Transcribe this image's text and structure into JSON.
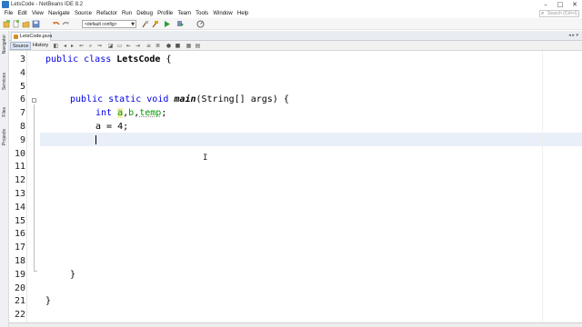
{
  "window": {
    "title": "LetsCode - NetBeans IDE 8.2",
    "controls": {
      "minimize": "–",
      "maximize": "□",
      "close": "✕"
    }
  },
  "menu": {
    "items": [
      "File",
      "Edit",
      "View",
      "Navigate",
      "Source",
      "Refactor",
      "Run",
      "Debug",
      "Profile",
      "Team",
      "Tools",
      "Window",
      "Help"
    ],
    "search_placeholder": "Search (Ctrl+I)",
    "search_icon": "search-icon"
  },
  "toolbar": {
    "config_value": "<default config>",
    "icons": [
      "new-project-icon",
      "new-file-icon",
      "open-project-icon",
      "save-all-icon",
      "undo-icon",
      "redo-icon",
      "clean-build-icon",
      "build-icon",
      "run-icon",
      "debug-icon",
      "profile-icon"
    ]
  },
  "side_tabs": [
    "Navigator",
    "Services",
    "Files",
    "Projects"
  ],
  "editor_tab": {
    "label": "LetsCode.java",
    "icon": "java-file-icon"
  },
  "editor_toolbar": {
    "source_label": "Source",
    "history_label": "History"
  },
  "colors": {
    "keyword": "#0000e6",
    "field": "#009900",
    "current_line": "#e9eff8"
  },
  "editor": {
    "line_numbers": [
      "3",
      "4",
      "5",
      "6",
      "7",
      "8",
      "9",
      "10",
      "11",
      "12",
      "13",
      "14",
      "15",
      "16",
      "17",
      "18",
      "19",
      "20",
      "21",
      "22"
    ],
    "lines": {
      "l3": {
        "kw": "public class",
        "name": "LetsCode",
        "rest": " {"
      },
      "l6": {
        "kw": "public static void",
        "method": "main",
        "rest": "(String[] args) {"
      },
      "l7": {
        "kw": "int",
        "v1": "a",
        "sep1": ",",
        "v2": "b",
        "sep2": ",",
        "v3": "temp",
        "end": ";"
      },
      "l8": {
        "text": "a = 4;"
      },
      "l19": {
        "text": "}"
      },
      "l21": {
        "text": "}"
      }
    }
  }
}
